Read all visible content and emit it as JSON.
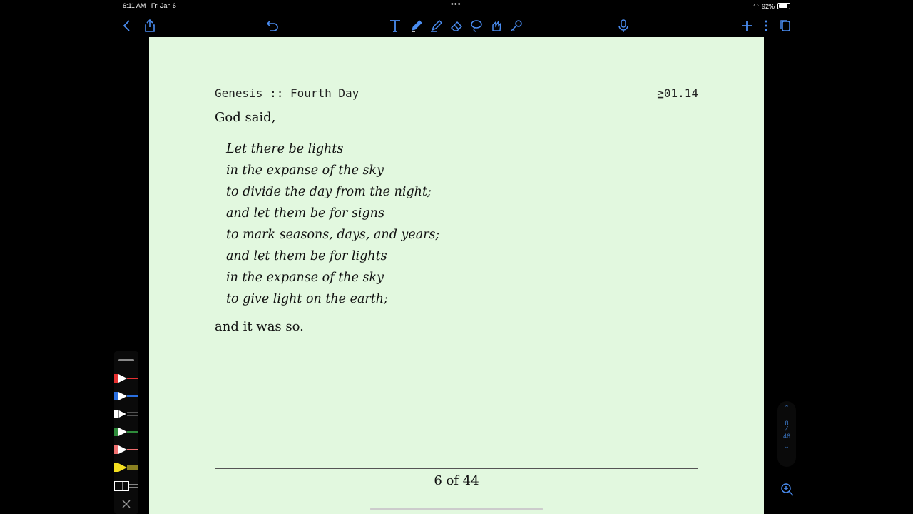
{
  "status": {
    "time": "6:11 AM",
    "date": "Fri Jan 6",
    "battery": "92%"
  },
  "toolbar": {
    "icons": [
      "back-icon",
      "share-icon",
      "undo-icon",
      "text-tool-icon",
      "pen-icon",
      "highlighter-icon",
      "eraser-icon",
      "lasso-icon",
      "shape-icon",
      "link-icon",
      "microphone-icon",
      "add-icon",
      "more-icon",
      "pages-icon"
    ]
  },
  "document": {
    "header_left": "Genesis :: Fourth Day",
    "header_right": "≧01.14",
    "intro": "God said,",
    "lines": [
      "Let there be lights",
      "in the expanse of the sky",
      "to divide the day from the night;",
      "and let them be for signs",
      "to mark seasons, days, and years;",
      "and let them be for lights",
      "in the expanse of the sky",
      "to give light on the earth;"
    ],
    "closing": "and it was so.",
    "page_label": "6 of 44"
  },
  "pens": [
    {
      "name": "red-pen",
      "color": "#e53030"
    },
    {
      "name": "blue-pen",
      "color": "#2a6fe0"
    },
    {
      "name": "white-pen",
      "color": "#ffffff"
    },
    {
      "name": "green-pen",
      "color": "#2e8b3a"
    },
    {
      "name": "pink-pen",
      "color": "#f07070"
    },
    {
      "name": "yellow-highlighter",
      "color": "#f5e020"
    },
    {
      "name": "eraser-tool",
      "color": "#ffffff"
    }
  ],
  "page_nav": {
    "current": "8",
    "total": "46"
  }
}
